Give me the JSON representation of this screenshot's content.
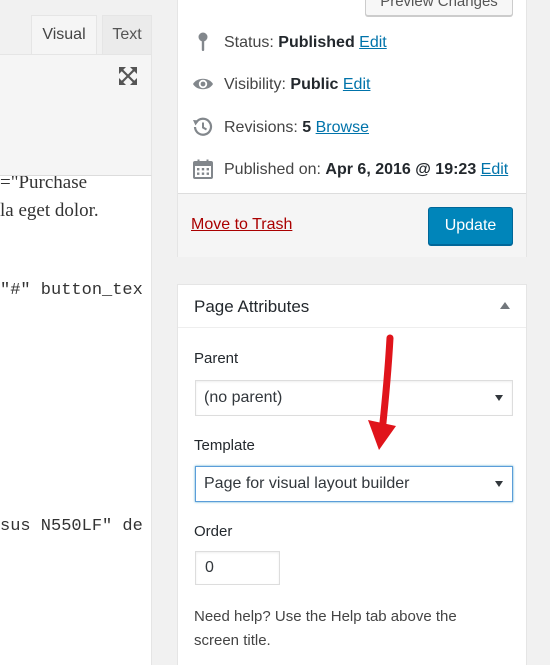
{
  "editor": {
    "tabs": {
      "visual": "Visual",
      "text": "Text"
    },
    "toolbar": {
      "expand_icon": "fullscreen-expand-icon"
    },
    "content_lines": [
      "=\"Purchase",
      "la eget dolor.",
      "\"#\" button_tex",
      "sus N550LF\" de"
    ]
  },
  "publish": {
    "preview_label": "Preview Changes",
    "status": {
      "icon": "pin-icon",
      "label": "Status:",
      "value": "Published",
      "link": "Edit"
    },
    "visibility": {
      "icon": "eye-icon",
      "label": "Visibility:",
      "value": "Public",
      "link": "Edit"
    },
    "revisions": {
      "icon": "history-icon",
      "label": "Revisions:",
      "value": "5",
      "link": "Browse"
    },
    "published_on": {
      "icon": "calendar-icon",
      "label": "Published on:",
      "value": "Apr 6, 2016 @ 19:23",
      "link": "Edit"
    },
    "trash_label": "Move to Trash",
    "update_label": "Update"
  },
  "page_attributes": {
    "title": "Page Attributes",
    "parent": {
      "label": "Parent",
      "selected": "(no parent)"
    },
    "template": {
      "label": "Template",
      "selected": "Page for visual layout builder"
    },
    "order": {
      "label": "Order",
      "value": "0"
    },
    "help": "Need help? Use the Help tab above the screen title."
  },
  "colors": {
    "link": "#0073aa",
    "trash": "#a00000",
    "primary_button": "#0085ba",
    "annotation_arrow": "#e0141b"
  }
}
